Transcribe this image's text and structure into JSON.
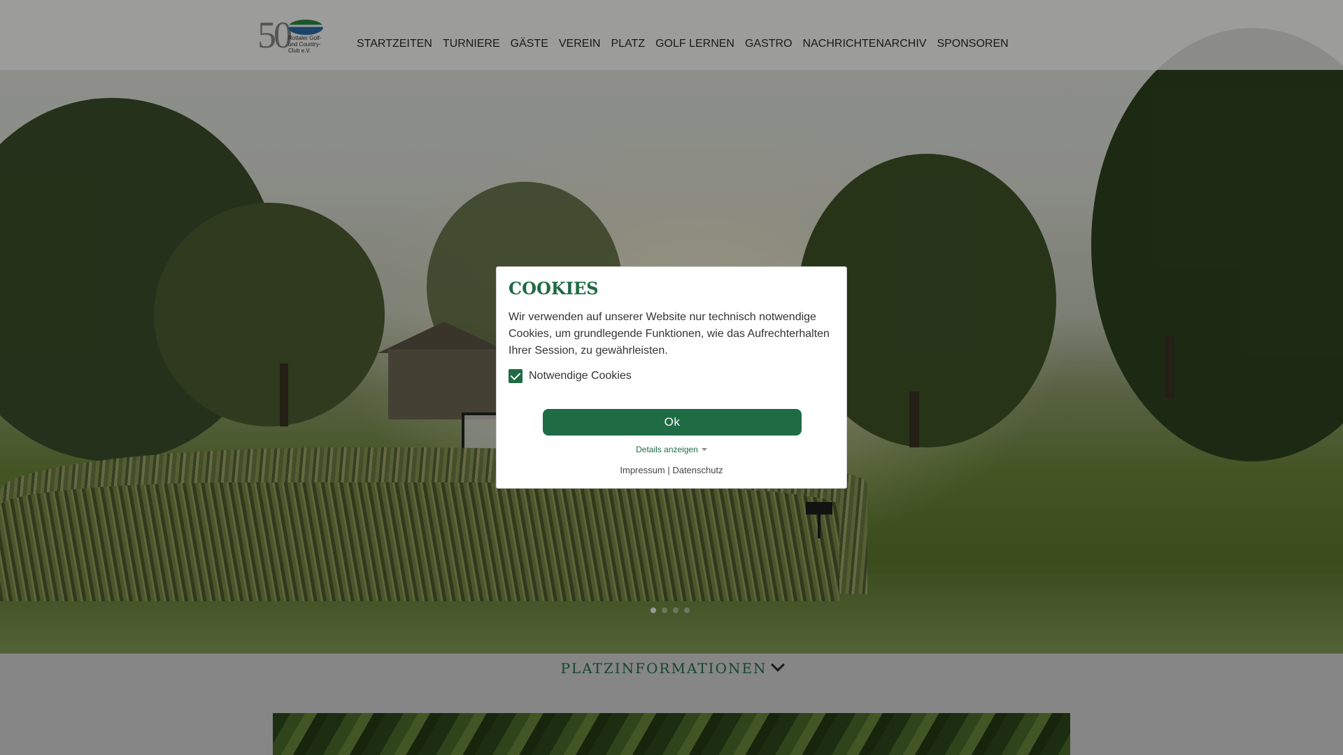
{
  "header": {
    "logo": {
      "number": "50",
      "club_name": "Rottaler Golf- und Country-Club e.V."
    },
    "nav": [
      "STARTZEITEN",
      "TURNIERE",
      "GÄSTE",
      "VEREIN",
      "PLATZ",
      "GOLF LERNEN",
      "GASTRO",
      "NACHRICHTENARCHIV",
      "SPONSOREN"
    ]
  },
  "slider": {
    "dots": 4,
    "active": 1
  },
  "section": {
    "title": "PLATZINFORMATIONEN"
  },
  "cookie": {
    "title": "COOKIES",
    "text": "Wir verwenden auf unserer Website nur technisch notwendige Cookies, um grundlegende Funktionen, wie das Aufrechterhalten Ihrer Session, zu gewährleisten.",
    "checkbox_label": "Notwendige Cookies",
    "checkbox_checked": true,
    "ok_label": "Ok",
    "details_label": "Details anzeigen",
    "impressum_label": "Impressum",
    "separator": "|",
    "datenschutz_label": "Datenschutz"
  },
  "colors": {
    "brand_green": "#1f6b44",
    "overlay": "rgba(0,0,0,0.38)"
  }
}
